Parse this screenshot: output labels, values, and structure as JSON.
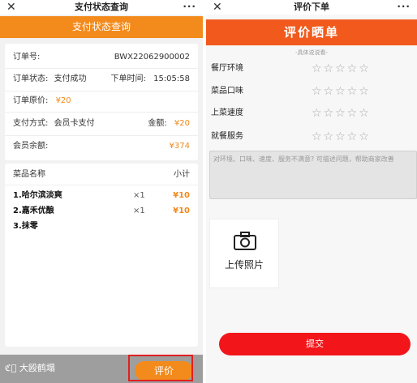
{
  "left": {
    "title": "支付状态查询",
    "banner": "支付状态查询",
    "order_no_label": "订单号:",
    "order_no_value": "BWX22062900002",
    "status_label": "订单状态:",
    "status_value": "支付成功",
    "time_label": "下单时间:",
    "time_value": "15:05:58",
    "original_label": "订单原价:",
    "original_value": "¥20",
    "pay_method_label": "支付方式:",
    "pay_method_value": "会员卡支付",
    "amount_label": "金额:",
    "amount_value": "¥20",
    "balance_label": "会员余额:",
    "balance_value": "¥374",
    "items_header": "菜品名称",
    "subtotal_header": "小计",
    "items": [
      {
        "name": "1.哈尔滨淡爽",
        "qty": "×1",
        "price": "¥10"
      },
      {
        "name": "2.嘉禾优酿",
        "qty": "×1",
        "price": "¥10"
      },
      {
        "name": "3.抹零",
        "qty": "",
        "price": ""
      }
    ],
    "watermark": "大殴鹤塌",
    "rate_button": "评价"
  },
  "right": {
    "title": "评价下单",
    "banner": "评价晒单",
    "subtitle": "-具体说说看-",
    "criteria": [
      "餐厅环境",
      "菜品口味",
      "上菜速度",
      "就餐服务"
    ],
    "star_glyphs": "☆☆☆☆☆",
    "feedback_placeholder": "对环境、口味、速度、服务不满意? 可描述问题，帮助商家改善",
    "upload_label": "上传照片",
    "submit_label": "提交"
  },
  "common": {
    "close_glyph": "✕",
    "more_glyph": "···"
  },
  "colors": {
    "orange": "#f38a1c",
    "red_orange": "#f25a1d",
    "red": "#f2161b",
    "highlight": "#e02020"
  }
}
